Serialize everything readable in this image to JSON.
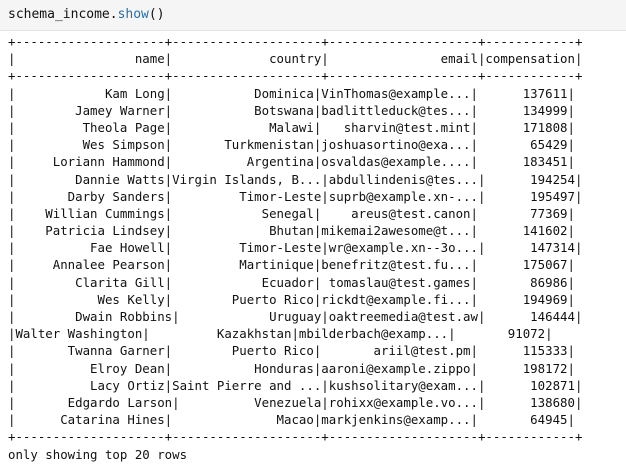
{
  "input": {
    "var": "schema_income",
    "dot": ".",
    "method": "show",
    "parens": "()"
  },
  "table": {
    "border": "+--------------------+--------------------+--------------------+------------+",
    "header": "|                name|             country|               email|compensation|",
    "rows": [
      "|            Kam Long|           Dominica|VinThomas@example...|      137611|",
      "|        Jamey Warner|           Botswana|badlittleduck@tes...|      134999|",
      "|         Theola Page|             Malawi|   sharvin@test.mint|      171808|",
      "|         Wes Simpson|       Turkmenistan|joshuasortino@exa...|       65429|",
      "|     Loriann Hammond|          Argentina|osvaldas@example....|      183451|",
      "|        Dannie Watts|Virgin Islands, B...|abdullindenis@tes...|      194254|",
      "|       Darby Sanders|         Timor-Leste|suprb@example.xn-...|      195497|",
      "|    Willian Cummings|            Senegal|    areus@test.canon|       77369|",
      "|    Patricia Lindsey|             Bhutan|mikemai2awesome@t...|      141602|",
      "|          Fae Howell|         Timor-Leste|wr@example.xn--3o...|      147314|",
      "|     Annalee Pearson|         Martinique|benefritz@test.fu...|      175067|",
      "|        Clarita Gill|            Ecuador| tomaslau@test.games|       86986|",
      "|           Wes Kelly|        Puerto Rico|rickdt@example.fi...|      194969|",
      "|        Dwain Robbins|            Uruguay|oaktreemedia@test.aw|      146444|",
      "|Walter Washington|         Kazakhstan|mbilderbach@examp...|       91072|",
      "|       Twanna Garner|        Puerto Rico|       ariil@test.pm|      115333|",
      "|          Elroy Dean|           Honduras|aaroni@example.zippo|      198172|",
      "|          Lacy Ortiz|Saint Pierre and ...|kushsolitary@exam...|      102871|",
      "|       Edgardo Larson|          Venezuela|rohixx@example.vo...|      138680|",
      "|      Catarina Hines|              Macao|markjenkins@examp...|       64945|"
    ],
    "footer": "only showing top 20 rows"
  }
}
